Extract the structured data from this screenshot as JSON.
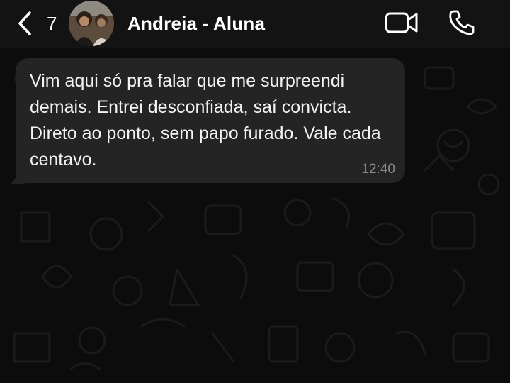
{
  "header": {
    "unread_count": "7",
    "contact_name": "Andreia - Aluna",
    "back_icon": "chevron-left-icon",
    "video_icon": "video-camera-icon",
    "call_icon": "phone-icon"
  },
  "messages": [
    {
      "direction": "incoming",
      "text": "Vim aqui só pra falar que me surpreendi\ndemais. Entrei desconfiada, saí convicta.\nDireto ao ponto, sem papo furado. Vale cada\ncentavo.",
      "time": "12:40"
    }
  ],
  "colors": {
    "background": "#0c0c0c",
    "header": "#131313",
    "incoming_bubble": "#242424",
    "text": "#f2f2f2",
    "timestamp": "#8c8c8c"
  }
}
